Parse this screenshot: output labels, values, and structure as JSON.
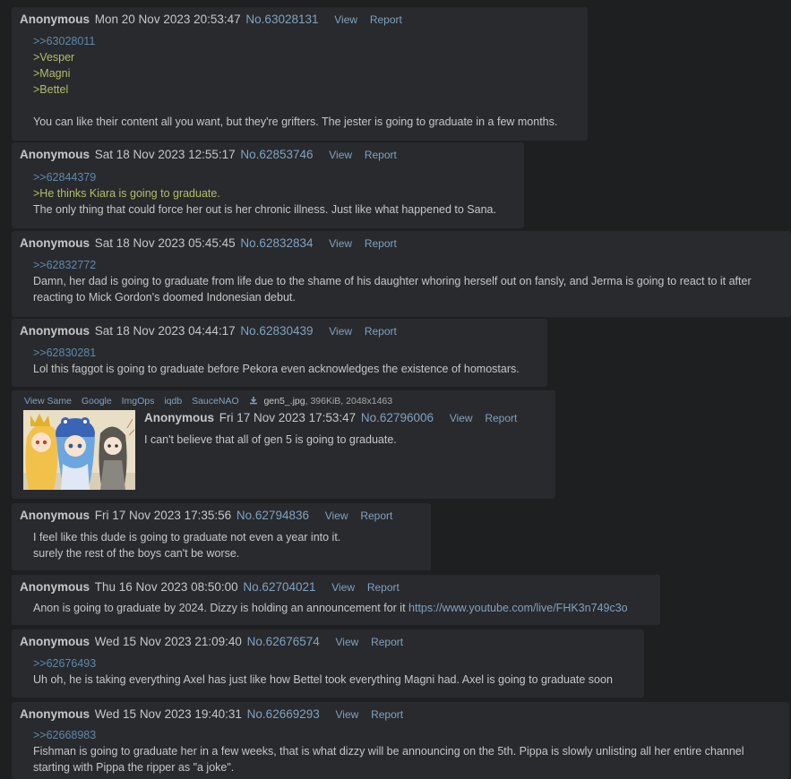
{
  "posts": [
    {
      "name": "Anonymous",
      "date": "Mon 20 Nov 2023 20:53:47",
      "num": "No.63028131",
      "view": "View",
      "report": "Report",
      "lines": [
        ">>63028011",
        ">Vesper",
        ">Magni",
        ">Bettel",
        "",
        "You can like their content all you want, but they're grifters. The jester is going to graduate in a few months."
      ]
    },
    {
      "name": "Anonymous",
      "date": "Sat 18 Nov 2023 12:55:17",
      "num": "No.62853746",
      "view": "View",
      "report": "Report",
      "lines": [
        ">>62844379",
        ">He thinks Kiara is going to graduate.",
        "The only thing that could force her out is her chronic illness. Just like what happened to Sana."
      ]
    },
    {
      "name": "Anonymous",
      "date": "Sat 18 Nov 2023 05:45:45",
      "num": "No.62832834",
      "view": "View",
      "report": "Report",
      "lines": [
        ">>62832772",
        "Damn, her dad is going to graduate from life due to the shame of his daughter whoring herself out on fansly, and Jerma is going to react to it after",
        "reacting to Mick Gordon's doomed Indonesian debut."
      ]
    },
    {
      "name": "Anonymous",
      "date": "Sat 18 Nov 2023 04:44:17",
      "num": "No.62830439",
      "view": "View",
      "report": "Report",
      "lines": [
        ">>62830281",
        "Lol this faggot is going to graduate before Pekora even acknowledges the existence of homostars."
      ]
    },
    {
      "name": "Anonymous",
      "date": "Fri 17 Nov 2023 17:53:47",
      "num": "No.62796006",
      "view": "View",
      "report": "Report",
      "file": {
        "links": [
          "View Same",
          "Google",
          "ImgOps",
          "iqdb",
          "SauceNAO"
        ],
        "filename": "gen5_.jpg",
        "info": ", 396KiB, 2048x1463"
      },
      "lines": [
        "I can't believe that all of gen 5 is going to graduate."
      ]
    },
    {
      "name": "Anonymous",
      "date": "Fri 17 Nov 2023 17:35:56",
      "num": "No.62794836",
      "view": "View",
      "report": "Report",
      "lines": [
        "I feel like this dude is going to graduate not even a year into it.",
        "surely the rest of the boys can't be worse."
      ]
    },
    {
      "name": "Anonymous",
      "date": "Thu 16 Nov 2023 08:50:00",
      "num": "No.62704021",
      "view": "View",
      "report": "Report",
      "lines": [
        "Anon is going to graduate by 2024. Dizzy is holding an announcement for it "
      ],
      "url": "https://www.youtube.com/live/FHK3n749c3o"
    },
    {
      "name": "Anonymous",
      "date": "Wed 15 Nov 2023 21:09:40",
      "num": "No.62676574",
      "view": "View",
      "report": "Report",
      "lines": [
        ">>62676493",
        "Uh oh, he is taking everything Axel has just like how Bettel took everything Magni had. Axel is going to graduate soon"
      ]
    },
    {
      "name": "Anonymous",
      "date": "Wed 15 Nov 2023 19:40:31",
      "num": "No.62669293",
      "view": "View",
      "report": "Report",
      "lines": [
        ">>62668983",
        "Fishman is going to graduate her in a few weeks, that is what dizzy will be announcing on the 5th. Pippa is slowly unlisting all her entire channel",
        "starting with Pippa the ripper as \"a joke\"."
      ]
    }
  ]
}
